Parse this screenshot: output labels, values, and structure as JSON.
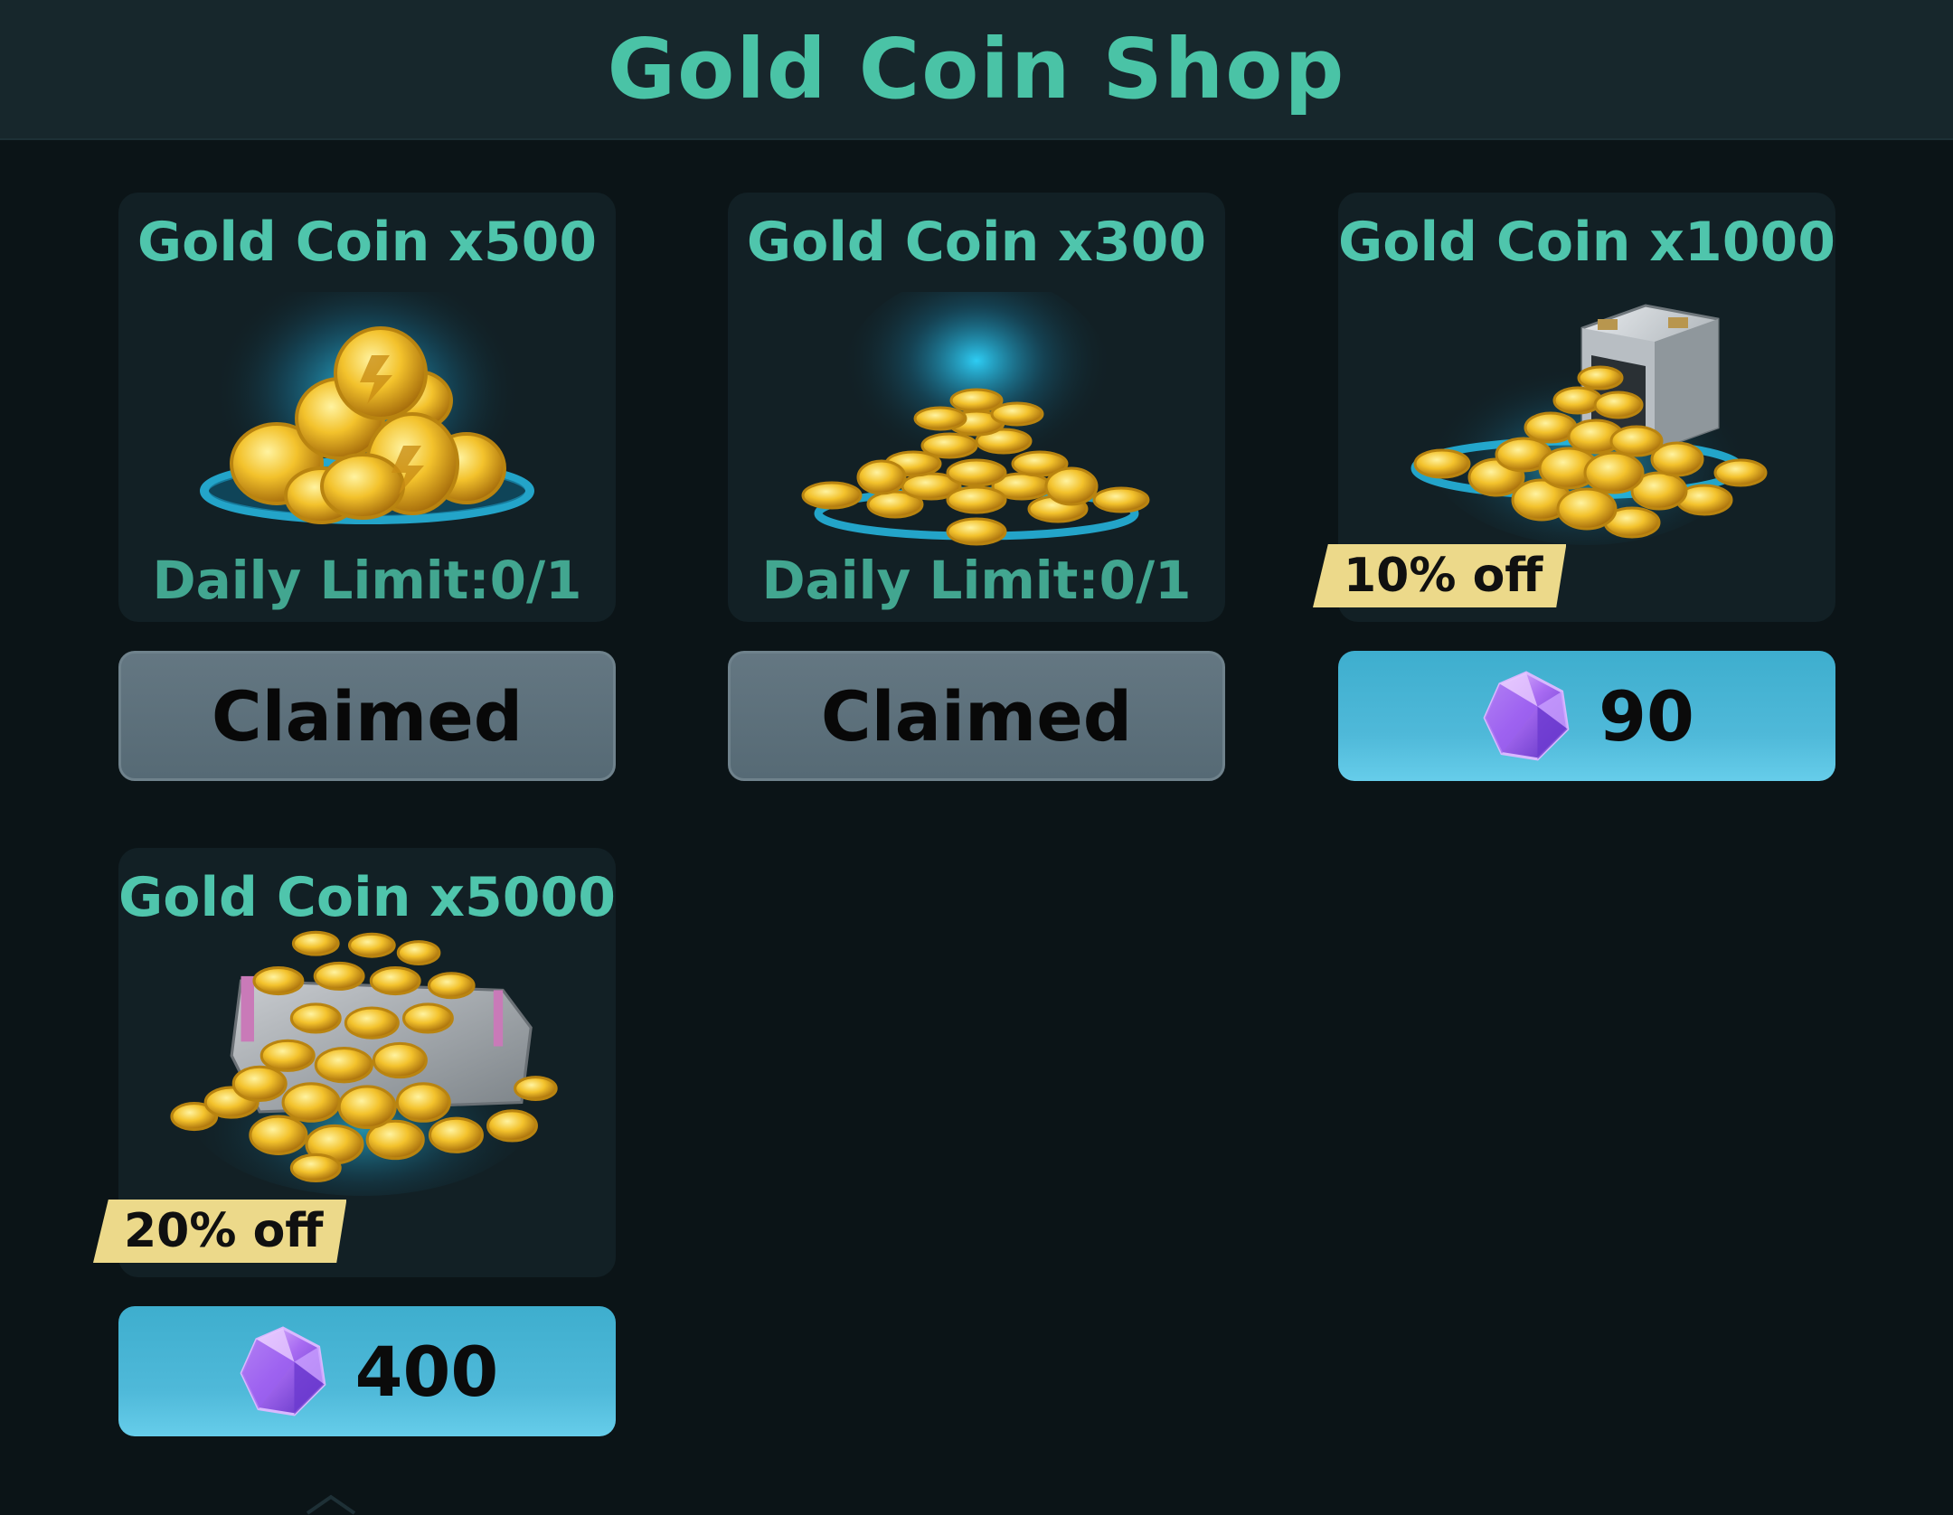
{
  "header": {
    "title": "Gold Coin Shop"
  },
  "items": [
    {
      "title": "Gold Coin x500",
      "art_icon": "coin-pile-small-icon",
      "daily_limit": "Daily Limit:0/1",
      "discount": "",
      "button_state": "claimed",
      "button_label": "Claimed",
      "price": ""
    },
    {
      "title": "Gold Coin x300",
      "art_icon": "coin-pile-flat-icon",
      "daily_limit": "Daily Limit:0/1",
      "discount": "",
      "button_state": "claimed",
      "button_label": "Claimed",
      "price": ""
    },
    {
      "title": "Gold Coin x1000",
      "art_icon": "coin-safe-icon",
      "daily_limit": "",
      "discount": "10% off",
      "button_state": "buy",
      "button_label": "",
      "price": "90",
      "currency_icon": "purple-gem-icon"
    },
    {
      "title": "Gold Coin x5000",
      "art_icon": "coin-chest-icon",
      "daily_limit": "",
      "discount": "20% off",
      "button_state": "buy",
      "button_label": "",
      "price": "400",
      "currency_icon": "purple-gem-icon"
    }
  ],
  "colors": {
    "background": "#0b1417",
    "header_bg": "#17272c",
    "title_teal": "#4ac3a6",
    "card_bg": "#122025",
    "claimed_button": "#5d707b",
    "buy_button": "#4fb9d9",
    "discount_tag": "#ecd98a",
    "gem_purple": "#9b6cf0"
  }
}
